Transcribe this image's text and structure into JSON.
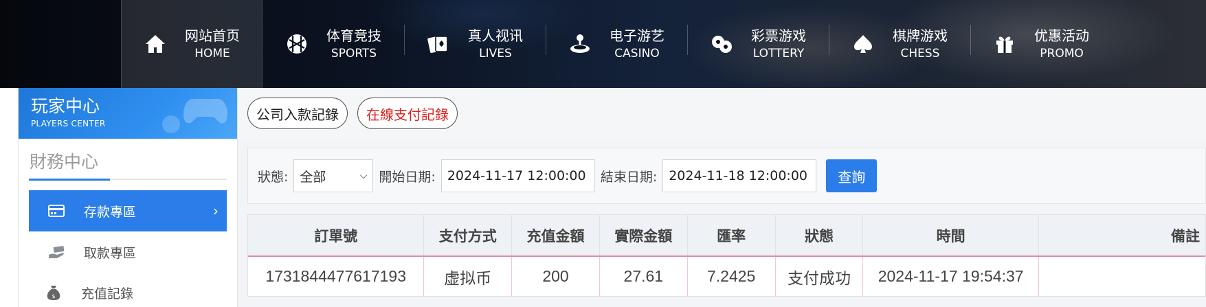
{
  "nav": [
    {
      "cn": "网站首页",
      "en": "HOME",
      "icon": "home-icon"
    },
    {
      "cn": "体育竞技",
      "en": "SPORTS",
      "icon": "ball-icon"
    },
    {
      "cn": "真人视讯",
      "en": "LIVES",
      "icon": "cards-icon"
    },
    {
      "cn": "电子游艺",
      "en": "CASINO",
      "icon": "joystick-icon"
    },
    {
      "cn": "彩票游戏",
      "en": "LOTTERY",
      "icon": "lottery-balls-icon"
    },
    {
      "cn": "棋牌游戏",
      "en": "CHESS",
      "icon": "spade-icon"
    },
    {
      "cn": "优惠活动",
      "en": "PROMO",
      "icon": "gift-icon"
    }
  ],
  "sidebar": {
    "title": "玩家中心",
    "subtitle": "PLAYERS CENTER",
    "section": "財務中心",
    "items": [
      {
        "label": "存款專區",
        "icon": "wallet-icon",
        "active": true
      },
      {
        "label": "取款專區",
        "icon": "cash-hand-icon",
        "active": false
      },
      {
        "label": "充值記錄",
        "icon": "money-bag-icon",
        "active": false
      }
    ]
  },
  "tabs": [
    {
      "label": "公司入款記錄",
      "active": false
    },
    {
      "label": "在線支付記錄",
      "active": true
    }
  ],
  "filter": {
    "status_label": "狀態:",
    "status_value": "全部",
    "start_label": "開始日期:",
    "start_value": "2024-11-17 12:00:00",
    "end_label": "結束日期:",
    "end_value": "2024-11-18 12:00:00",
    "query_label": "查詢"
  },
  "table": {
    "headers": [
      "訂單號",
      "支付方式",
      "充值金額",
      "實際金額",
      "匯率",
      "狀態",
      "時間",
      "備註"
    ],
    "rows": [
      [
        "1731844477617193",
        "虚拟币",
        "200",
        "27.61",
        "7.2425",
        "支付成功",
        "2024-11-17 19:54:37",
        ""
      ]
    ]
  },
  "colors": {
    "accent": "#2b7de9",
    "active_tab_text": "#e02020"
  }
}
